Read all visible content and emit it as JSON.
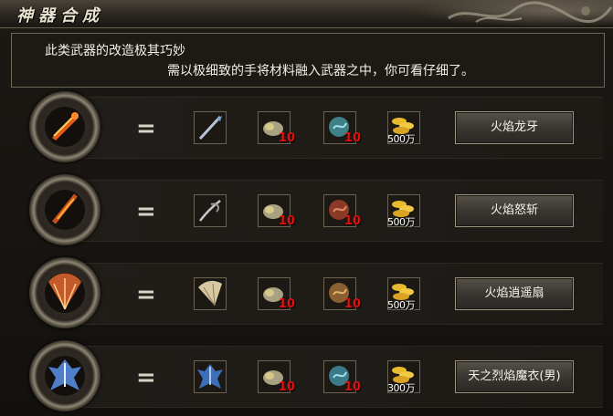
{
  "window": {
    "title": "神器合成"
  },
  "description": {
    "line1": "此类武器的改造极其巧妙",
    "line2": "需以极细致的手将材料融入武器之中，你可看仔细了。"
  },
  "recipes": [
    {
      "result_icon": "flame-dragon-fang-icon",
      "equals": "=",
      "weapon_icon": "dragon-fang-icon",
      "material1_qty": "10",
      "material2_qty": "10",
      "material2_color": "#3f7f86",
      "gold_cost": "500万",
      "button": "火焰龙牙"
    },
    {
      "result_icon": "flame-wrath-blade-icon",
      "equals": "=",
      "weapon_icon": "wrath-blade-icon",
      "material1_qty": "10",
      "material2_qty": "10",
      "material2_color": "#8a3a26",
      "gold_cost": "500万",
      "button": "火焰怒斩"
    },
    {
      "result_icon": "flame-fan-icon",
      "equals": "=",
      "weapon_icon": "fan-icon",
      "material1_qty": "10",
      "material2_qty": "10",
      "material2_color": "#8b6030",
      "gold_cost": "500万",
      "button": "火焰逍遥扇"
    },
    {
      "result_icon": "heaven-flame-robe-icon",
      "equals": "=",
      "weapon_icon": "robe-icon",
      "material1_qty": "10",
      "material2_qty": "10",
      "material2_color": "#3c7a8a",
      "gold_cost": "300万",
      "button": "天之烈焰魔衣(男)"
    }
  ]
}
